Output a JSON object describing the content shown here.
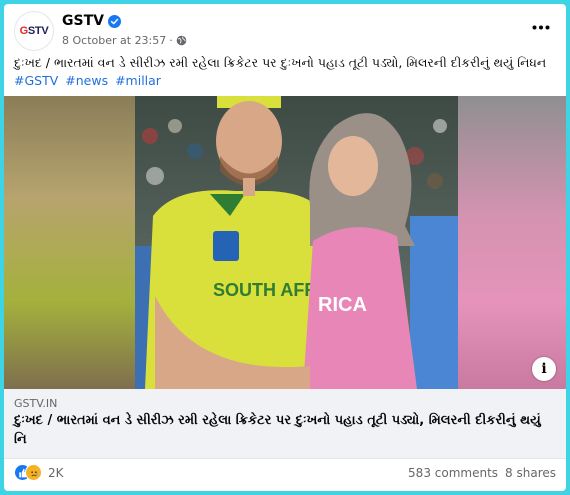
{
  "post": {
    "page_name": "GSTV",
    "avatar_logo": "GSTV",
    "timestamp": "8 October at 23:57",
    "privacy_icon": "globe-icon",
    "text": "દુઃખદ / ભારતમાં વન ડે સીરીઝ રમી રહેલા ક્રિકેટર પર દુઃખનો પહાડ તૂટી પડ્યો, મિલરની દીકરીનું થયું નિધન",
    "hashtags": [
      "#GSTV",
      "#news",
      "#millar"
    ]
  },
  "photo": {
    "jersey_text_left": "SOUTH AFRICA",
    "jersey_text_right": "RICA",
    "info_label": "i"
  },
  "link": {
    "domain": "GSTV.IN",
    "title": "દુઃખદ / ભારતમાં વન ડે સીરીઝ રમી રહેલા ક્રિકેટર પર દુઃખનો પહાડ તૂટી પડ્યો, મિલરની દીકરીનું થયું નિ"
  },
  "engagement": {
    "reaction_count": "2K",
    "comments": "583 comments",
    "shares": "8 shares"
  },
  "colors": {
    "background": "#3fd3e6",
    "link_blue": "#216fdb",
    "like_blue": "#1877f2",
    "sad_yellow": "#f7b125",
    "jersey_yellow": "#d9df3b",
    "jersey_pink": "#e886b7"
  }
}
